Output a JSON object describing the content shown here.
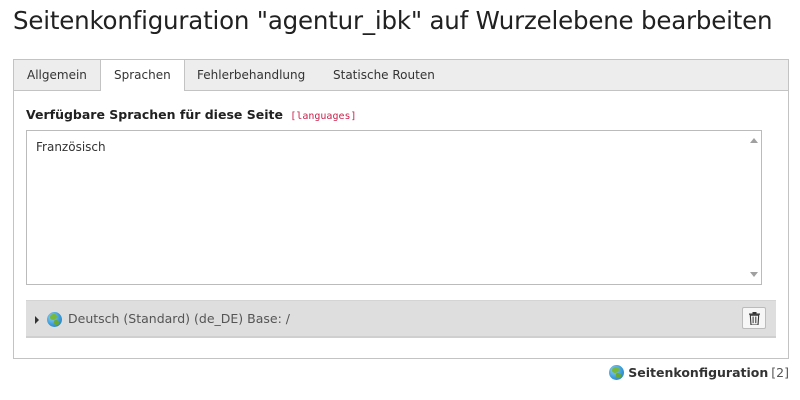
{
  "page": {
    "title": "Seitenkonfiguration \"agentur_ibk\" auf Wurzelebene bearbeiten"
  },
  "tabs": [
    {
      "label": "Allgemein",
      "active": false
    },
    {
      "label": "Sprachen",
      "active": true
    },
    {
      "label": "Fehlerbehandlung",
      "active": false
    },
    {
      "label": "Statische Routen",
      "active": false
    }
  ],
  "languages_field": {
    "label": "Verfügbare Sprachen für diese Seite",
    "key": "[languages]",
    "options": [
      "Französisch"
    ]
  },
  "language_record": {
    "icon": "globe-icon",
    "title": "Deutsch (Standard) (de_DE) Base: /",
    "delete_icon": "trash-icon"
  },
  "footer": {
    "icon": "globe-icon",
    "label": "Seitenkonfiguration",
    "count": "[2]"
  },
  "colors": {
    "field_key": "#c7254e",
    "tabbar_bg": "#ededed",
    "record_bg": "#dedede"
  }
}
